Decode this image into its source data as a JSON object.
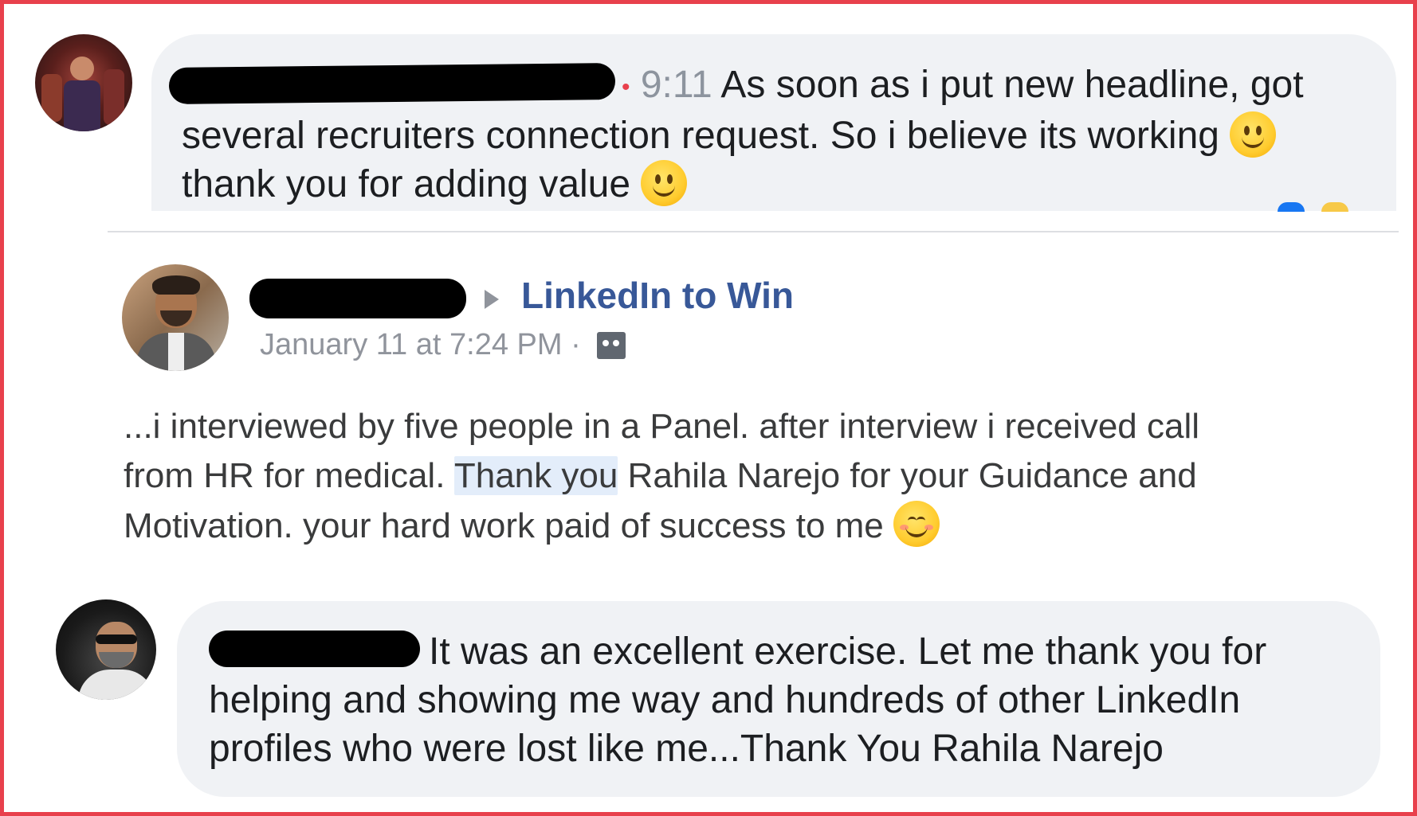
{
  "comment1": {
    "author": "",
    "time": "9:11",
    "lines": [
      "As soon as i put new headline, got",
      "several recruiters connection request. So i believe its working",
      "thank you for adding value"
    ],
    "emoji": [
      "slightly-smiling-face",
      "slightly-smiling-face"
    ]
  },
  "post": {
    "author": "",
    "group": "LinkedIn to Win",
    "timestamp": "January 11 at 7:24 PM",
    "separator": "·",
    "audience_icon": "group-audience-icon",
    "body": {
      "line1": "...i interviewed by five people in a Panel. after interview i received call",
      "line2_before": "from HR for medical. ",
      "line2_highlight": "Thank you",
      "line2_after": " Rahila Narejo for your Guidance and",
      "line3": "Motivation. your hard work paid of success to me"
    },
    "emoji": "smiling-face-with-smiling-eyes"
  },
  "comment2": {
    "author": "",
    "lines": [
      "It was an excellent exercise. Let me thank you for",
      "helping and showing me way and hundreds of other LinkedIn",
      "profiles who were lost like me...Thank You Rahila Narejo"
    ]
  },
  "colors": {
    "frame": "#e8404c",
    "bubble": "#f0f2f5",
    "group_link": "#385898",
    "muted": "#90949c"
  }
}
